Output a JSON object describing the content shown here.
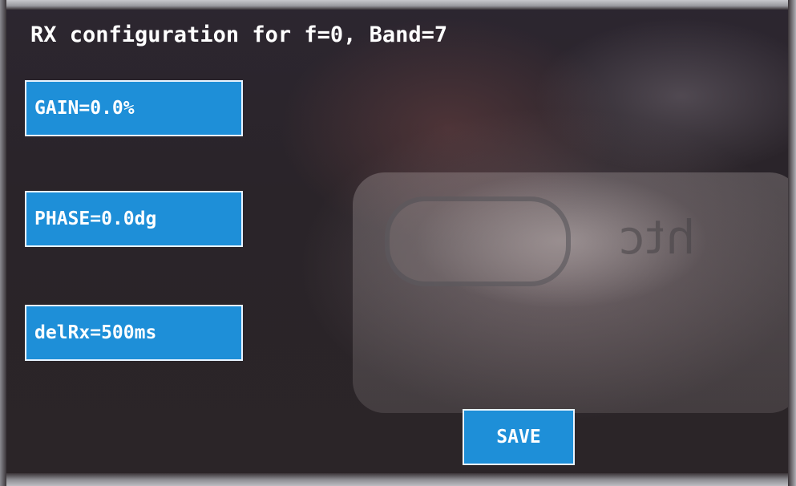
{
  "header": {
    "title": "RX configuration for f=0, Band=7"
  },
  "fields": {
    "gain_label": "GAIN=0.0%",
    "phase_label": "PHASE=0.0dg",
    "delrx_label": "delRx=500ms"
  },
  "actions": {
    "save_label": "SAVE"
  },
  "colors": {
    "button_fill": "#1e8fd8",
    "button_border": "#e8f4ff",
    "text": "#ffffff",
    "background": "#2a2328"
  }
}
